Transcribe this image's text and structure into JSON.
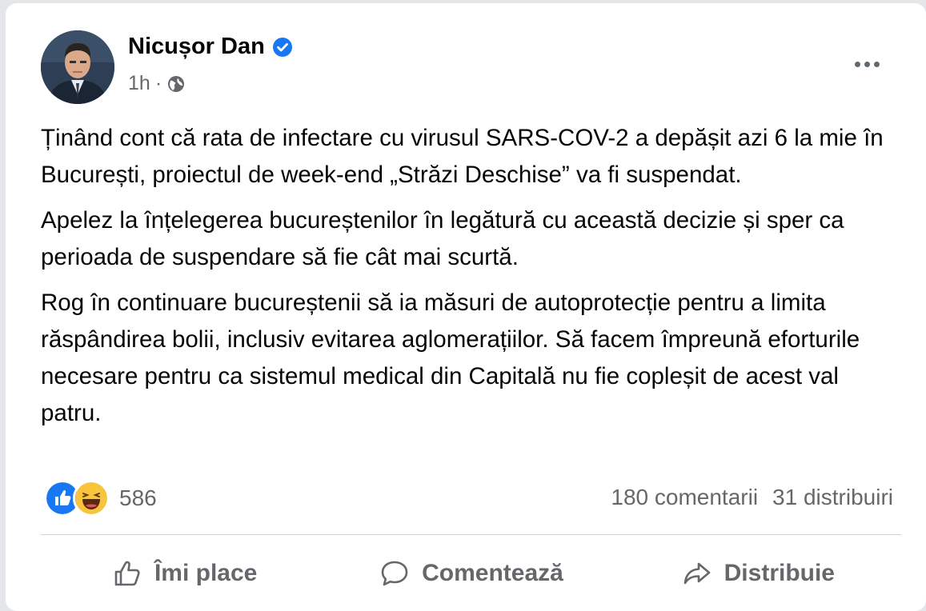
{
  "post": {
    "author": "Nicușor Dan",
    "time": "1h",
    "time_separator": "·",
    "paragraphs": [
      "Ținând cont că rata de infectare cu virusul SARS-COV-2 a depășit azi 6 la mie în București, proiectul de week-end „Străzi Deschise” va fi suspendat.",
      "Apelez la înțelegerea bucureștenilor în legătură cu această decizie și sper ca perioada de suspendare să fie cât mai scurtă.",
      "Rog în continuare bucureștenii să ia măsuri de autoprotecție pentru a limita răspândirea bolii, inclusiv evitarea aglomerațiilor. Să facem împreună eforturile necesare pentru ca sistemul medical din Capitală nu fie copleșit de acest val patru."
    ],
    "reaction_icons": [
      "like-icon",
      "haha-icon"
    ],
    "reaction_count": "586",
    "comments": "180 comentarii",
    "shares": "31 distribuiri"
  },
  "actions": {
    "like": "Îmi place",
    "comment": "Comentează",
    "share": "Distribuie"
  },
  "colors": {
    "verified": "#1877f2",
    "muted_text": "#65676b",
    "like_blue": "#1877f2",
    "haha_yellow": "#f7c43b"
  }
}
